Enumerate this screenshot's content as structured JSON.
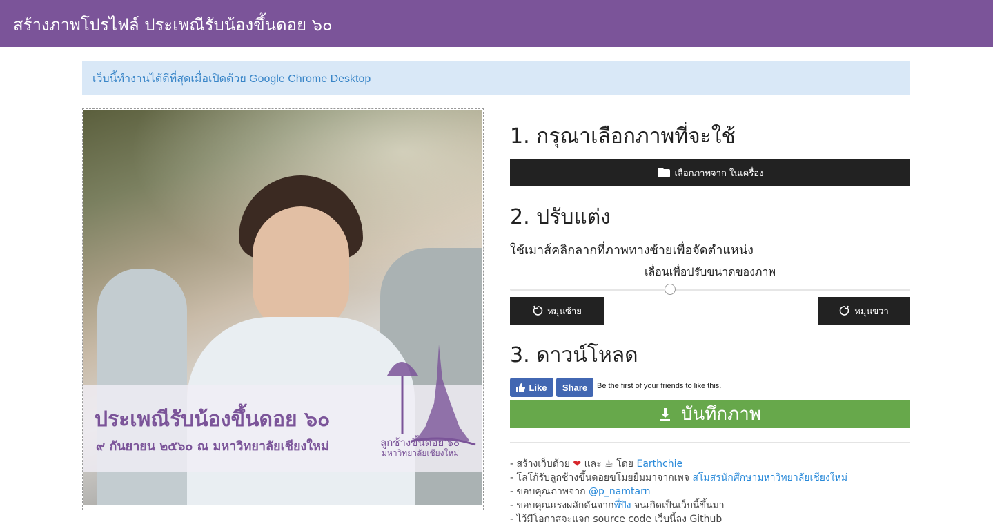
{
  "header": {
    "title": "สร้างภาพโปรไฟล์ ประเพณีรับน้องขึ้นดอย ๖๐"
  },
  "alert": {
    "text": "เว็บนี้ทำงานได้ดีที่สุดเมื่อเปิดด้วย Google Chrome Desktop"
  },
  "preview": {
    "overlay_line1": "ประเพณีรับน้องขึ้นดอย ๖๐",
    "overlay_line2": "๙ กันยายน ๒๕๖๐ ณ มหาวิทยาลัยเชียงใหม่",
    "logo_line1": "ลูกช้างขึ้นดอย'๖๐",
    "logo_line2": "มหาวิทยาลัยเชียงใหม่"
  },
  "step1": {
    "heading": "1. กรุณาเลือกภาพที่จะใช้",
    "choose_button": "เลือกภาพจาก ในเครื่อง"
  },
  "step2": {
    "heading": "2. ปรับแต่ง",
    "hint": "ใช้เมาส์คลิกลากที่ภาพทางซ้ายเพื่อจัดตำแหน่ง",
    "slider_label": "เลื่อนเพื่อปรับขนาดของภาพ",
    "slider_value": 0.4,
    "rotate_left": "หมุนซ้าย",
    "rotate_right": "หมุนขวา"
  },
  "step3": {
    "heading": "3. ดาวน์โหลด",
    "like": "Like",
    "share": "Share",
    "like_text": "Be the first of your friends to like this.",
    "save_button": "บันทึกภาพ"
  },
  "credits": {
    "line1_pre": "- สร้างเว็บด้วย",
    "line1_mid": "และ",
    "line1_by": "โดย",
    "line1_link": "Earthchie",
    "line2_pre": "- โลโก้รับลูกช้างขึ้นดอยขโมยยืมมาจากเพจ",
    "line2_link": "สโมสรนักศึกษามหาวิทยาลัยเชียงใหม่",
    "line3_pre": "- ขอบคุณภาพจาก",
    "line3_link": "@p_namtarn",
    "line4_pre": "- ขอบคุณแรงผลักดันจาก",
    "line4_link": "พี่ปิง",
    "line4_post": "จนเกิดเป็นเว็บนี้ขึ้นมา",
    "line5": "- ไว้มีโอกาสจะแจก source code เว็บนี้ลง Github"
  },
  "colors": {
    "header": "#7b5499",
    "alert_bg": "#d9e8f7",
    "link": "#2a8ad9",
    "save": "#67a84b",
    "dark_button": "#222222",
    "facebook": "#4267b2"
  },
  "icons": [
    "folder-icon",
    "rotate-left-icon",
    "rotate-right-icon",
    "download-icon",
    "thumbs-up-icon",
    "heart-icon",
    "coffee-icon"
  ]
}
